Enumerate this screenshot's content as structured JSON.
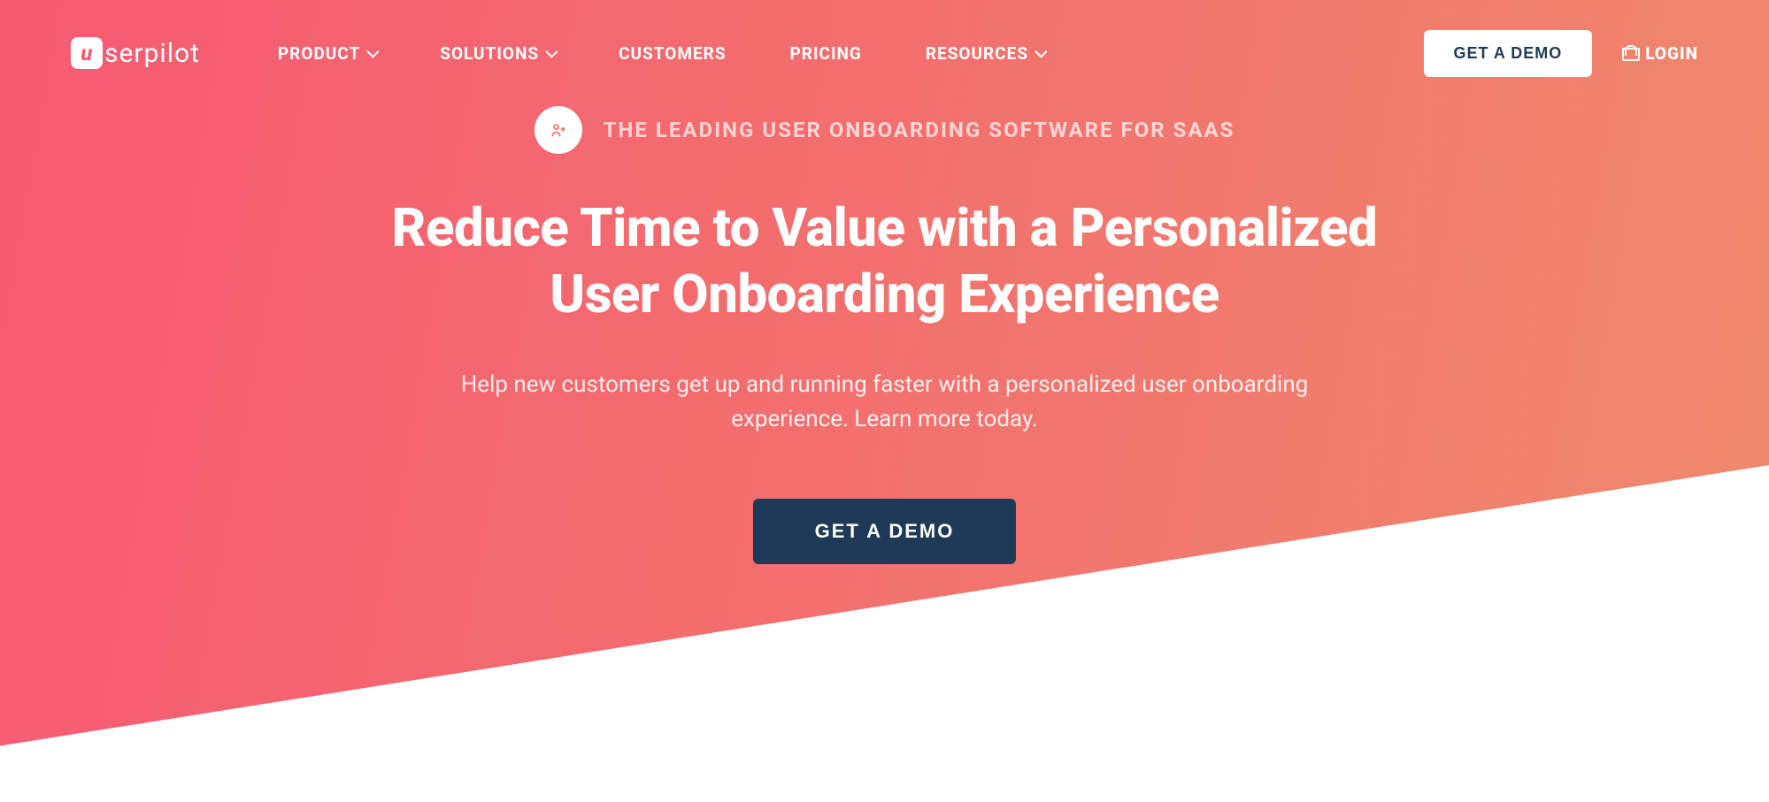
{
  "brand": {
    "mark": "u",
    "rest": "serpilot"
  },
  "nav": {
    "items": [
      {
        "label": "PRODUCT",
        "hasDropdown": true
      },
      {
        "label": "SOLUTIONS",
        "hasDropdown": true
      },
      {
        "label": "CUSTOMERS",
        "hasDropdown": false
      },
      {
        "label": "PRICING",
        "hasDropdown": false
      },
      {
        "label": "RESOURCES",
        "hasDropdown": true
      }
    ],
    "demo_label": "GET A DEMO",
    "login_label": "LOGIN"
  },
  "hero": {
    "eyebrow": "THE LEADING USER ONBOARDING SOFTWARE FOR SAAS",
    "headline": "Reduce Time to Value with a Personalized User Onboarding Experience",
    "subtext": "Help new customers get up and running faster with a personalized user onboarding experience. Learn more today.",
    "cta_label": "GET A DEMO"
  },
  "colors": {
    "gradient_start": "#f75a72",
    "gradient_end": "#ef8a6d",
    "cta_dark": "#1e3a56",
    "white": "#ffffff"
  }
}
